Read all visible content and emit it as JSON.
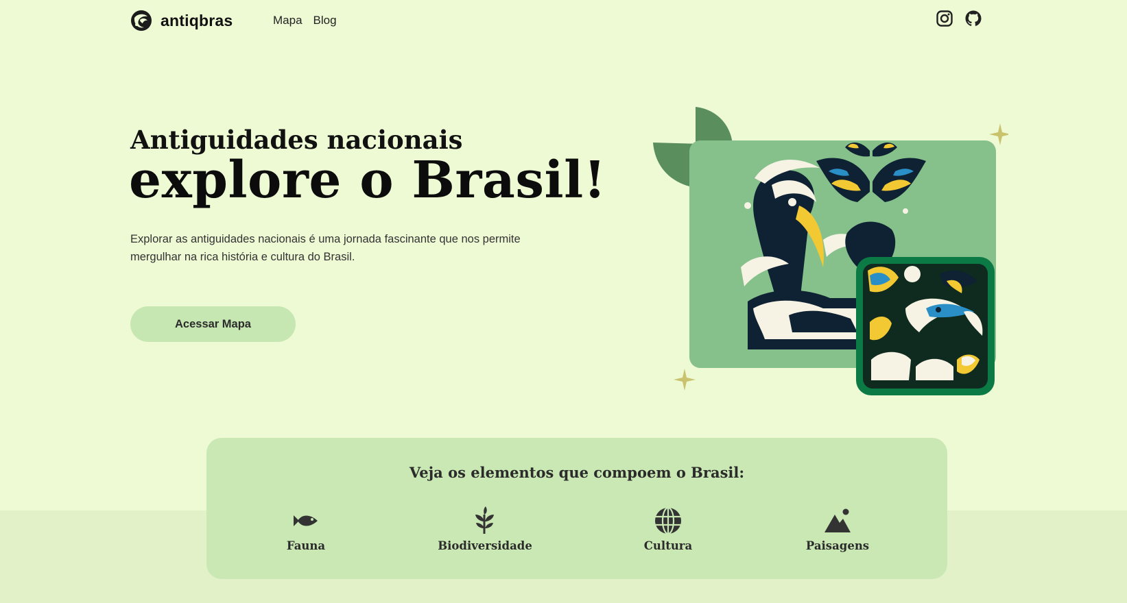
{
  "brand": {
    "name": "antiqbras",
    "logo_icon": "globe-swirl-icon"
  },
  "nav": {
    "items": [
      {
        "label": "Mapa"
      },
      {
        "label": "Blog"
      }
    ]
  },
  "social": {
    "items": [
      {
        "icon": "instagram-icon"
      },
      {
        "icon": "github-icon"
      }
    ]
  },
  "hero": {
    "kicker": "Antiguidades nacionais",
    "headline": "explore o Brasil!",
    "description": "Explorar as antiguidades nacionais é uma jornada fascinante que nos permite mergulhar na rica história e cultura do Brasil.",
    "cta_label": "Acessar Mapa"
  },
  "elements": {
    "title": "Veja os elementos que compoem o Brasil:",
    "items": [
      {
        "label": "Fauna",
        "icon": "fish-icon"
      },
      {
        "label": "Biodiversidade",
        "icon": "leaf-sprout-icon"
      },
      {
        "label": "Cultura",
        "icon": "globe-icon"
      },
      {
        "label": "Paisagens",
        "icon": "mountain-icon"
      }
    ]
  },
  "colors": {
    "page_bg": "#eefad4",
    "card_bg": "#c9e8b4",
    "button_bg": "#c6e7b2",
    "art_green": "#86c18b",
    "art_dark_green": "#0c7a45",
    "art_navy": "#0f2233",
    "art_yellow": "#f2c933",
    "art_blue": "#2a8fc7"
  }
}
